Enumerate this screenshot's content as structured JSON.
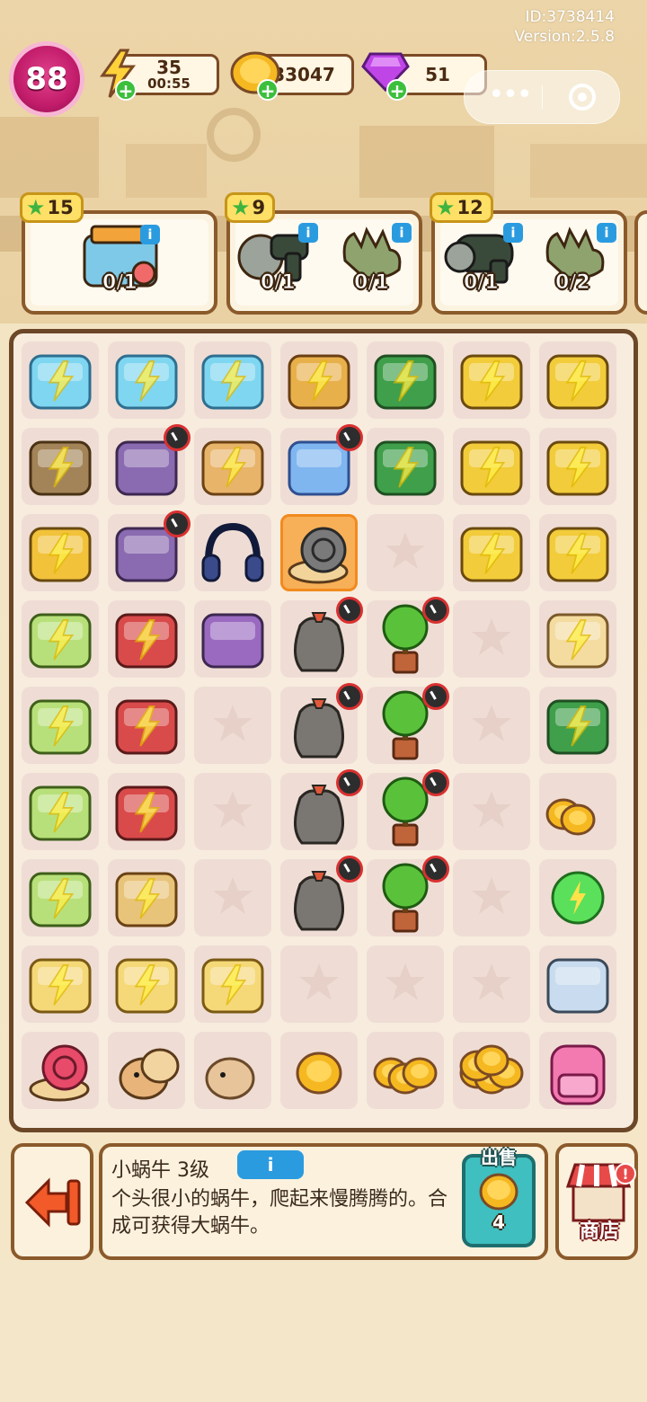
{
  "system": {
    "id_text": "ID:3738414",
    "version_text": "Version:2.5.8"
  },
  "player": {
    "level": "88"
  },
  "resources": {
    "energy": {
      "value": "35",
      "timer": "00:55"
    },
    "coins": {
      "value": "33047"
    },
    "gems": {
      "value": "51"
    }
  },
  "orders": [
    {
      "stars": "15",
      "requirements": [
        {
          "icon": "gym-fatgoose-icon",
          "count": "0/1"
        }
      ]
    },
    {
      "stars": "9",
      "requirements": [
        {
          "icon": "drill-icon",
          "count": "0/1"
        },
        {
          "icon": "glove-icon",
          "count": "0/1"
        }
      ]
    },
    {
      "stars": "12",
      "requirements": [
        {
          "icon": "hair-dryer-icon",
          "count": "0/1"
        },
        {
          "icon": "glove-icon",
          "count": "0/2"
        }
      ]
    }
  ],
  "board": {
    "rows": [
      [
        "robot-vacuum",
        "robot-vacuum",
        "robot-vacuum",
        "fruit-basket",
        "toolbox-green",
        "shopping-cart-tools",
        "shopping-cart-duck"
      ],
      [
        "cabinet",
        "clutter-pile",
        "moving-boxes",
        "swim-ring",
        "toolbox-green",
        "shopping-cart-tools",
        "shopping-cart-yellow"
      ],
      [
        "locker",
        "clutter-pile",
        "headphones",
        "snail",
        "empty",
        "shopping-cart-tools",
        "shopping-cart-yellow"
      ],
      [
        "laptop",
        "wheelbarrow",
        "coin-bag-purple",
        "garbage-bag",
        "potted-tree",
        "empty",
        "coin-sack"
      ],
      [
        "laptop",
        "wheelbarrow",
        "empty",
        "garbage-bag",
        "potted-tree",
        "empty",
        "cash-register"
      ],
      [
        "laptop",
        "tool-basket",
        "empty",
        "garbage-bag",
        "potted-tree",
        "empty",
        "coins-pair"
      ],
      [
        "laptop",
        "parcel-box",
        "empty",
        "garbage-bag",
        "potted-tree",
        "empty",
        "energy-orb"
      ],
      [
        "glass-cup",
        "glass-cup",
        "plant-cup",
        "empty",
        "empty",
        "empty",
        "clipboard"
      ],
      [
        "snail-big",
        "hamster-group",
        "hamster",
        "coin-single",
        "coins-stack",
        "coins-pile",
        "backpack"
      ]
    ]
  },
  "selected_item": {
    "name_text": "小蜗牛 3级",
    "description": "个头很小的蜗牛，爬起来慢腾腾的。合成可获得大蜗牛。",
    "sell_label": "出售",
    "sell_price": "4"
  },
  "shop": {
    "label": "商店"
  },
  "colors": {
    "level_badge": "#c21c6b",
    "board_border": "#6b4728",
    "info": "#2b9be0",
    "sell": "#3fbfbf"
  }
}
